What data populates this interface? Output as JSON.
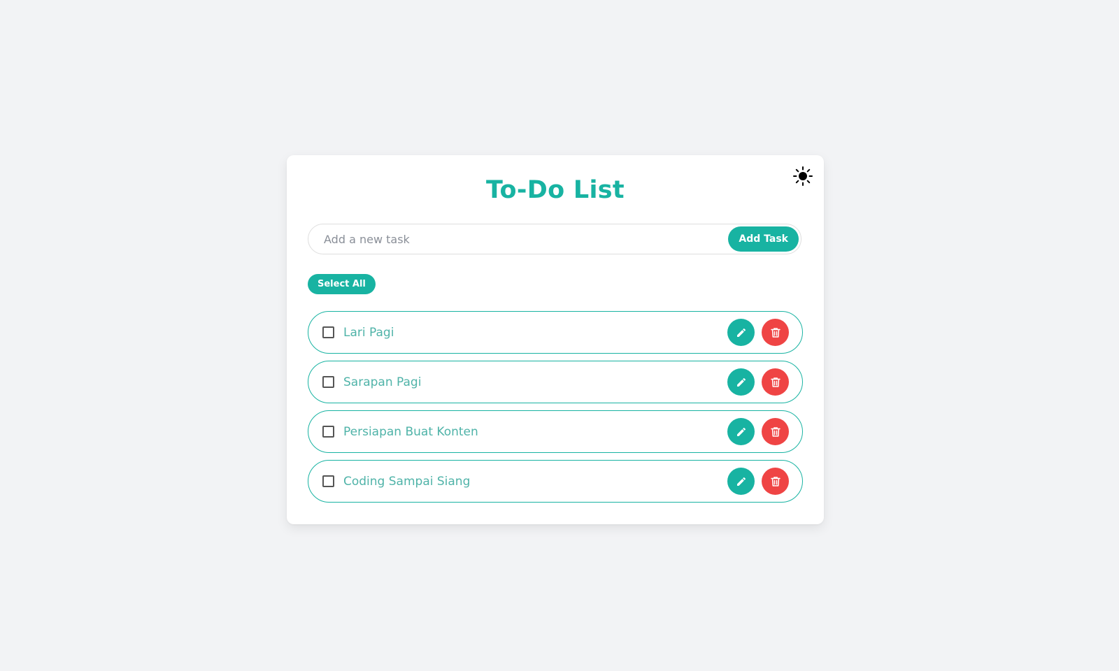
{
  "colors": {
    "accent": "#18b3a2",
    "danger": "#ef4444",
    "background": "#f2f3f5",
    "card": "#ffffff"
  },
  "header": {
    "title": "To-Do List",
    "theme_toggle_icon": "sun-icon"
  },
  "new_task": {
    "placeholder": "Add a new task",
    "value": "",
    "add_label": "Add Task"
  },
  "select_all_label": "Select All",
  "tasks": [
    {
      "text": "Lari Pagi",
      "checked": false
    },
    {
      "text": "Sarapan Pagi",
      "checked": false
    },
    {
      "text": "Persiapan Buat Konten",
      "checked": false
    },
    {
      "text": "Coding Sampai Siang",
      "checked": false
    }
  ],
  "icons": {
    "edit": "pencil-icon",
    "delete": "trash-icon"
  }
}
